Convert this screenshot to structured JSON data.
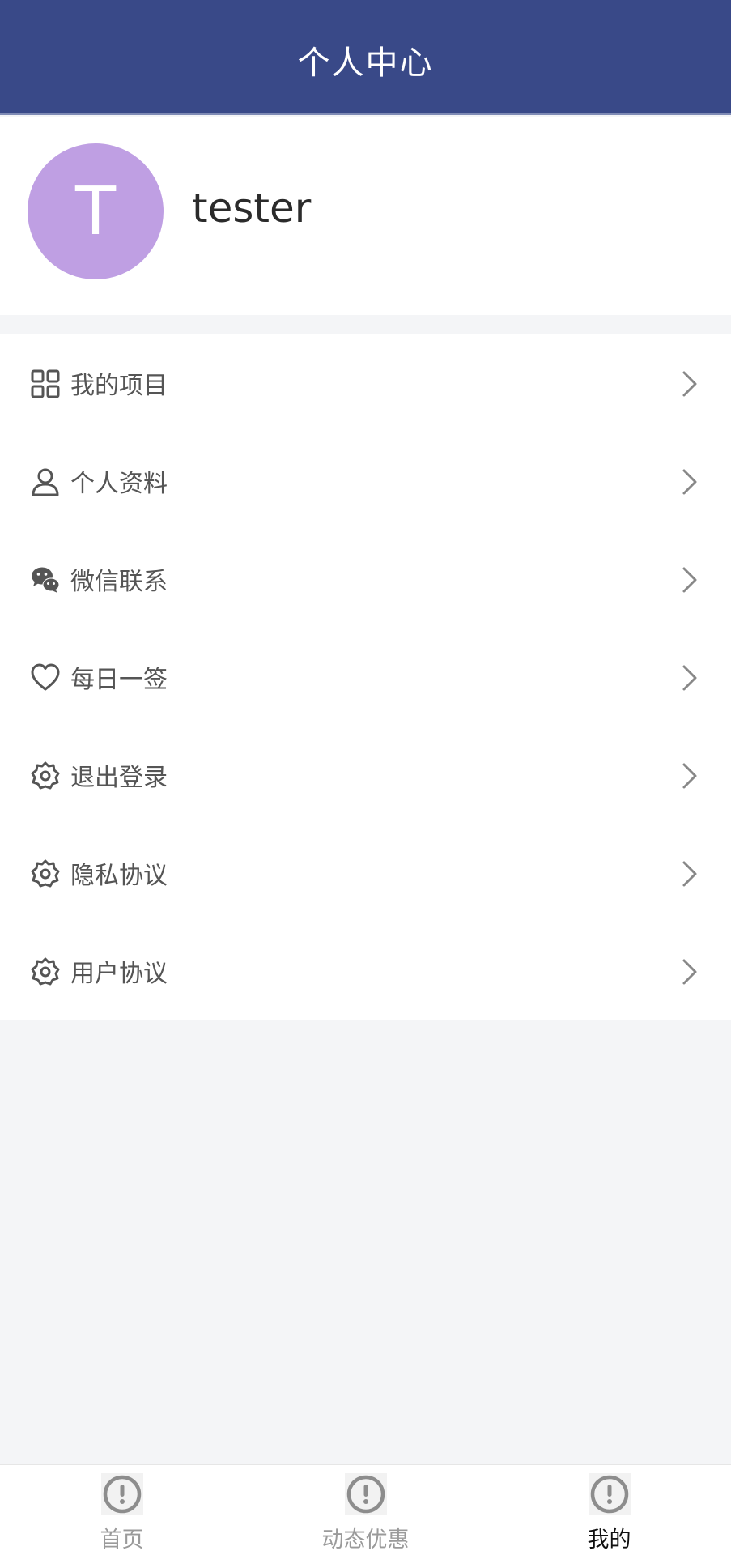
{
  "header": {
    "title": "个人中心"
  },
  "profile": {
    "avatar_letter": "T",
    "username": "tester",
    "avatar_color": "#bf9fe3"
  },
  "menu": {
    "items": [
      {
        "label": "我的项目",
        "icon": "grid-icon"
      },
      {
        "label": "个人资料",
        "icon": "user-icon"
      },
      {
        "label": "微信联系",
        "icon": "wechat-icon"
      },
      {
        "label": "每日一签",
        "icon": "heart-icon"
      },
      {
        "label": "退出登录",
        "icon": "gear-icon"
      },
      {
        "label": "隐私协议",
        "icon": "gear-icon"
      },
      {
        "label": "用户协议",
        "icon": "gear-icon"
      }
    ]
  },
  "tabbar": {
    "tabs": [
      {
        "label": "首页",
        "icon": "alert-circle-icon",
        "active": false
      },
      {
        "label": "动态优惠",
        "icon": "alert-circle-icon",
        "active": false
      },
      {
        "label": "我的",
        "icon": "alert-circle-icon",
        "active": true
      }
    ]
  },
  "colors": {
    "header_bg": "#394988",
    "page_bg": "#f4f5f7",
    "icon": "#555555"
  }
}
